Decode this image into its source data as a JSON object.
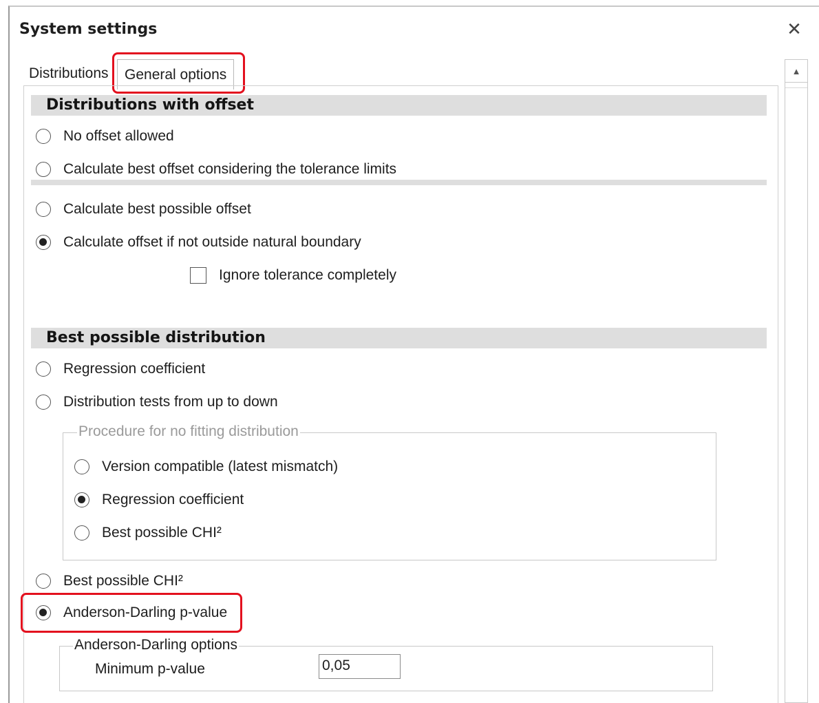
{
  "window": {
    "title": "System settings",
    "close_icon": "close-icon"
  },
  "tabs": [
    {
      "label": "Distributions",
      "selected": false
    },
    {
      "label": "General options",
      "selected": true
    }
  ],
  "offset_section": {
    "header": "Distributions with offset",
    "options": [
      {
        "label": "No offset allowed",
        "checked": false
      },
      {
        "label": "Calculate best offset considering the tolerance limits",
        "checked": false
      },
      {
        "label": "Calculate best possible offset",
        "checked": false
      },
      {
        "label": "Calculate offset if not outside natural boundary",
        "checked": true
      }
    ],
    "ignore_tolerance": {
      "label": "Ignore tolerance completely",
      "checked": false
    }
  },
  "distribution_section": {
    "header": "Best possible distribution",
    "options": [
      {
        "label": "Regression coefficient",
        "checked": false
      },
      {
        "label": "Distribution tests from up to down",
        "checked": false
      },
      {
        "label": "Best possible CHI²",
        "checked": false
      },
      {
        "label": "Anderson-Darling p-value",
        "checked": true
      }
    ],
    "no_fit_group": {
      "title": "Procedure for no fitting distribution",
      "options": [
        {
          "label": "Version compatible (latest mismatch)",
          "checked": false
        },
        {
          "label": "Regression coefficient",
          "checked": true
        },
        {
          "label": "Best possible CHI²",
          "checked": false
        }
      ]
    },
    "anderson_group": {
      "title": "Anderson-Darling options",
      "min_p_label": "Minimum p-value",
      "min_p_value": "0,05"
    }
  },
  "highlight_color": "#e3101e"
}
